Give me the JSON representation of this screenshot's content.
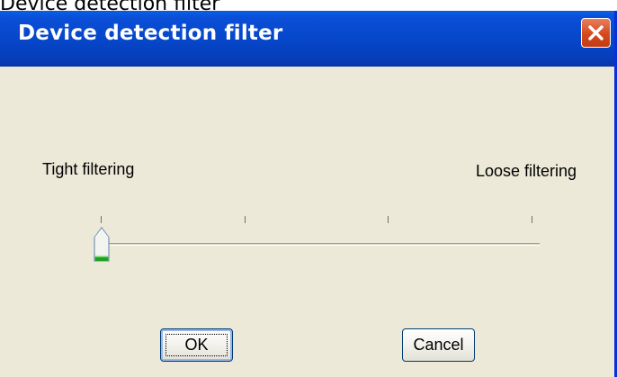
{
  "caption": "Device detection filter",
  "window": {
    "title": "Device detection filter",
    "close_icon": "close-icon"
  },
  "slider": {
    "left_label": "Tight filtering",
    "right_label": "Loose filtering",
    "tick_count": 4,
    "value_fraction": 0.0
  },
  "buttons": {
    "ok": "OK",
    "cancel": "Cancel"
  },
  "colors": {
    "titlebar": "#0646c8",
    "dialog_background": "#ece9d8",
    "close_button": "#d5491c",
    "thumb_accent": "#21a121"
  }
}
